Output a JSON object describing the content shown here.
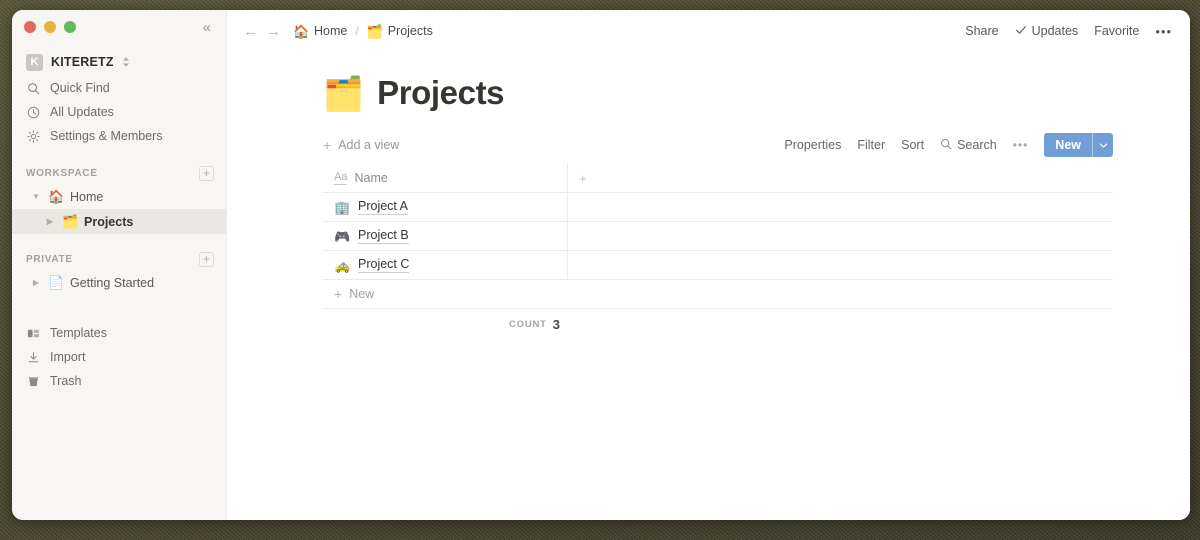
{
  "window": {
    "traffic_lights": [
      "close",
      "minimize",
      "zoom"
    ],
    "collapse_icon": "chevron-double-left",
    "colors": {
      "accent": "#6f9fd4",
      "sidebar_bg": "#f7f6f3",
      "text": "#37352f",
      "muted": "#8f8c86"
    }
  },
  "sidebar": {
    "workspace_name": "KITERETZ",
    "workspace_badge": "K",
    "quick_items": [
      {
        "label": "Quick Find",
        "icon": "search-icon"
      },
      {
        "label": "All Updates",
        "icon": "clock-icon"
      },
      {
        "label": "Settings & Members",
        "icon": "gear-icon"
      }
    ],
    "sections": [
      {
        "label": "WORKSPACE",
        "add_label": "+",
        "items": [
          {
            "label": "Home",
            "emoji": "🏠",
            "twisty": "open",
            "active": false,
            "indent": false
          },
          {
            "label": "Projects",
            "emoji": "🗂️",
            "twisty": "closed",
            "active": true,
            "indent": true
          }
        ]
      },
      {
        "label": "PRIVATE",
        "add_label": "+",
        "items": [
          {
            "label": "Getting Started",
            "emoji": "📄",
            "twisty": "closed",
            "active": false,
            "indent": false
          }
        ]
      }
    ],
    "bottom_items": [
      {
        "label": "Templates",
        "icon": "templates-icon"
      },
      {
        "label": "Import",
        "icon": "import-icon"
      },
      {
        "label": "Trash",
        "icon": "trash-icon"
      }
    ]
  },
  "topbar": {
    "back_icon": "arrow-left-icon",
    "forward_icon": "arrow-right-icon",
    "breadcrumbs": [
      {
        "label": "Home",
        "emoji": "🏠"
      },
      {
        "label": "Projects",
        "emoji": "🗂️"
      }
    ],
    "separator": "/",
    "actions": [
      {
        "label": "Share",
        "icon": ""
      },
      {
        "label": "Updates",
        "icon": "check-icon"
      },
      {
        "label": "Favorite",
        "icon": ""
      }
    ],
    "more_label": "•••"
  },
  "page": {
    "emoji": "🗂️",
    "title": "Projects"
  },
  "viewbar": {
    "add_view_label": "Add a view",
    "add_view_plus": "+",
    "controls": [
      {
        "label": "Properties",
        "icon": ""
      },
      {
        "label": "Filter",
        "icon": ""
      },
      {
        "label": "Sort",
        "icon": ""
      },
      {
        "label": "Search",
        "icon": "search-icon"
      }
    ],
    "more_label": "•••",
    "new_button": {
      "label": "New",
      "dropdown_icon": "chevron-down-icon"
    }
  },
  "table": {
    "columns": [
      {
        "label": "Name",
        "type_icon": "Aa"
      }
    ],
    "add_column_label": "+",
    "rows": [
      {
        "emoji": "🏢",
        "title": "Project A"
      },
      {
        "emoji": "🎮",
        "title": "Project B"
      },
      {
        "emoji": "🚕",
        "title": "Project C"
      }
    ],
    "new_row_label": "New",
    "new_row_plus": "+",
    "footer": {
      "count_label": "COUNT",
      "count_value": "3"
    }
  }
}
